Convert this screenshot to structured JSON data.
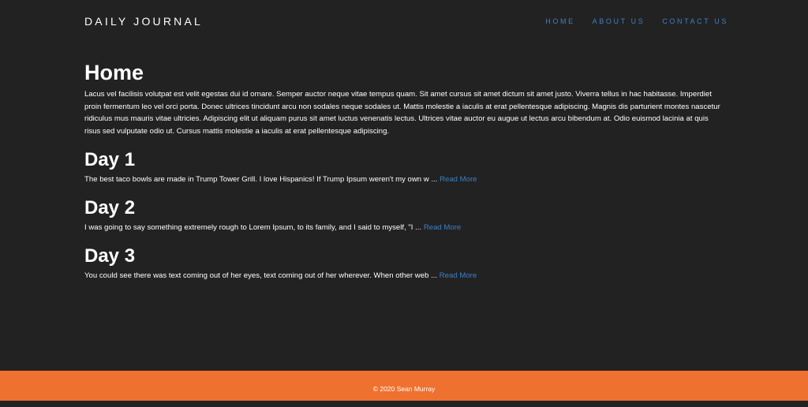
{
  "header": {
    "brand": "DAILY JOURNAL",
    "nav": [
      "HOME",
      "ABOUT US",
      "CONTACT US"
    ]
  },
  "home": {
    "title": "Home",
    "body": "Lacus vel facilisis volutpat est velit egestas dui id ornare. Semper auctor neque vitae tempus quam. Sit amet cursus sit amet dictum sit amet justo. Viverra tellus in hac habitasse. Imperdiet proin fermentum leo vel orci porta. Donec ultrices tincidunt arcu non sodales neque sodales ut. Mattis molestie a iaculis at erat pellentesque adipiscing. Magnis dis parturient montes nascetur ridiculus mus mauris vitae ultricies. Adipiscing elit ut aliquam purus sit amet luctus venenatis lectus. Ultrices vitae auctor eu augue ut lectus arcu bibendum at. Odio euismod lacinia at quis risus sed vulputate odio ut. Cursus mattis molestie a iaculis at erat pellentesque adipiscing."
  },
  "posts": [
    {
      "title": "Day 1",
      "excerpt": "The best taco bowls are made in Trump Tower Grill. I love Hispanics! If Trump Ipsum weren't my own w ... ",
      "link": "Read More"
    },
    {
      "title": "Day 2",
      "excerpt": "I was going to say something extremely rough to Lorem Ipsum, to its family, and I said to myself, \"I ... ",
      "link": "Read More"
    },
    {
      "title": "Day 3",
      "excerpt": "You could see there was text coming out of her eyes, text coming out of her wherever. When other web ... ",
      "link": "Read More"
    }
  ],
  "footer": {
    "text": "© 2020 Sean Murray"
  },
  "colors": {
    "background": "#222222",
    "accent": "#3f7fc4",
    "footer": "#ef712f"
  }
}
